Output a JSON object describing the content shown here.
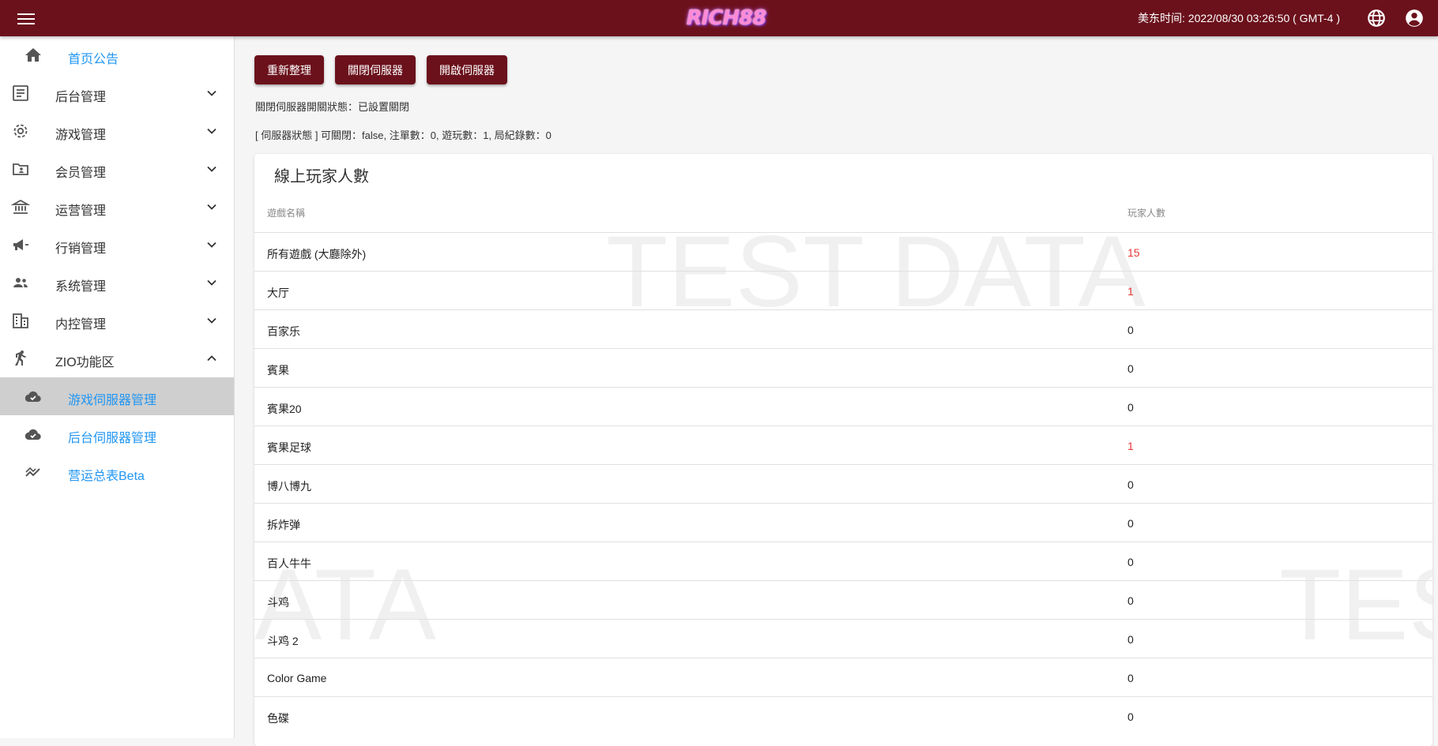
{
  "header": {
    "logo_text": "RICH88",
    "clock": "美东时间: 2022/08/30 03:26:50 ( GMT-4 )",
    "icons": [
      "menu-icon",
      "globe-icon",
      "account-circle-icon"
    ],
    "colors": {
      "bar": "#6b111c",
      "accent": "#2196f3",
      "highlight": "#e53935"
    }
  },
  "sidebar": {
    "items": [
      {
        "label": "首页公告",
        "icon": "home-icon"
      },
      {
        "label": "后台管理",
        "icon": "list-icon"
      },
      {
        "label": "游戏管理",
        "icon": "gear-icon"
      },
      {
        "label": "会员管理",
        "icon": "folder-user-icon"
      },
      {
        "label": "运营管理",
        "icon": "bank-icon"
      },
      {
        "label": "行销管理",
        "icon": "megaphone-icon"
      },
      {
        "label": "系统管理",
        "icon": "people-icon"
      },
      {
        "label": "内控管理",
        "icon": "building-icon"
      },
      {
        "label": "ZIO功能区",
        "icon": "runner-icon"
      },
      {
        "label": "游戏伺服器管理",
        "icon": "cloud-check-icon"
      },
      {
        "label": "后台伺服器管理",
        "icon": "cloud-check-icon"
      },
      {
        "label": "营运总表Beta",
        "icon": "trending-icon"
      }
    ]
  },
  "toolbar": {
    "refresh_label": "重新整理",
    "close_label": "關閉伺服器",
    "open_label": "開啟伺服器"
  },
  "status": {
    "switch_line": "關閉伺服器開關狀態：已設置關閉",
    "server_line": "[ 伺服器狀態 ] 可關閉：false, 注單數：0, 遊玩數：1, 局紀錄數：0"
  },
  "card": {
    "title": "線上玩家人數",
    "col_game": "遊戲名稱",
    "col_players": "玩家人數",
    "rows": [
      {
        "name": "所有遊戲 (大廳除外)",
        "count": "15"
      },
      {
        "name": "大厅",
        "count": "1"
      },
      {
        "name": "百家乐",
        "count": "0"
      },
      {
        "name": "賓果",
        "count": "0"
      },
      {
        "name": "賓果20",
        "count": "0"
      },
      {
        "name": "賓果足球",
        "count": "1"
      },
      {
        "name": "博八博九",
        "count": "0"
      },
      {
        "name": "拆炸弹",
        "count": "0"
      },
      {
        "name": "百人牛牛",
        "count": "0"
      },
      {
        "name": "斗鸡",
        "count": "0"
      },
      {
        "name": "斗鸡 2",
        "count": "0"
      },
      {
        "name": "Color Game",
        "count": "0"
      },
      {
        "name": "色碟",
        "count": "0"
      }
    ]
  },
  "watermark": {
    "main": "TEST DATA",
    "left": "ATA",
    "right": "TES"
  }
}
